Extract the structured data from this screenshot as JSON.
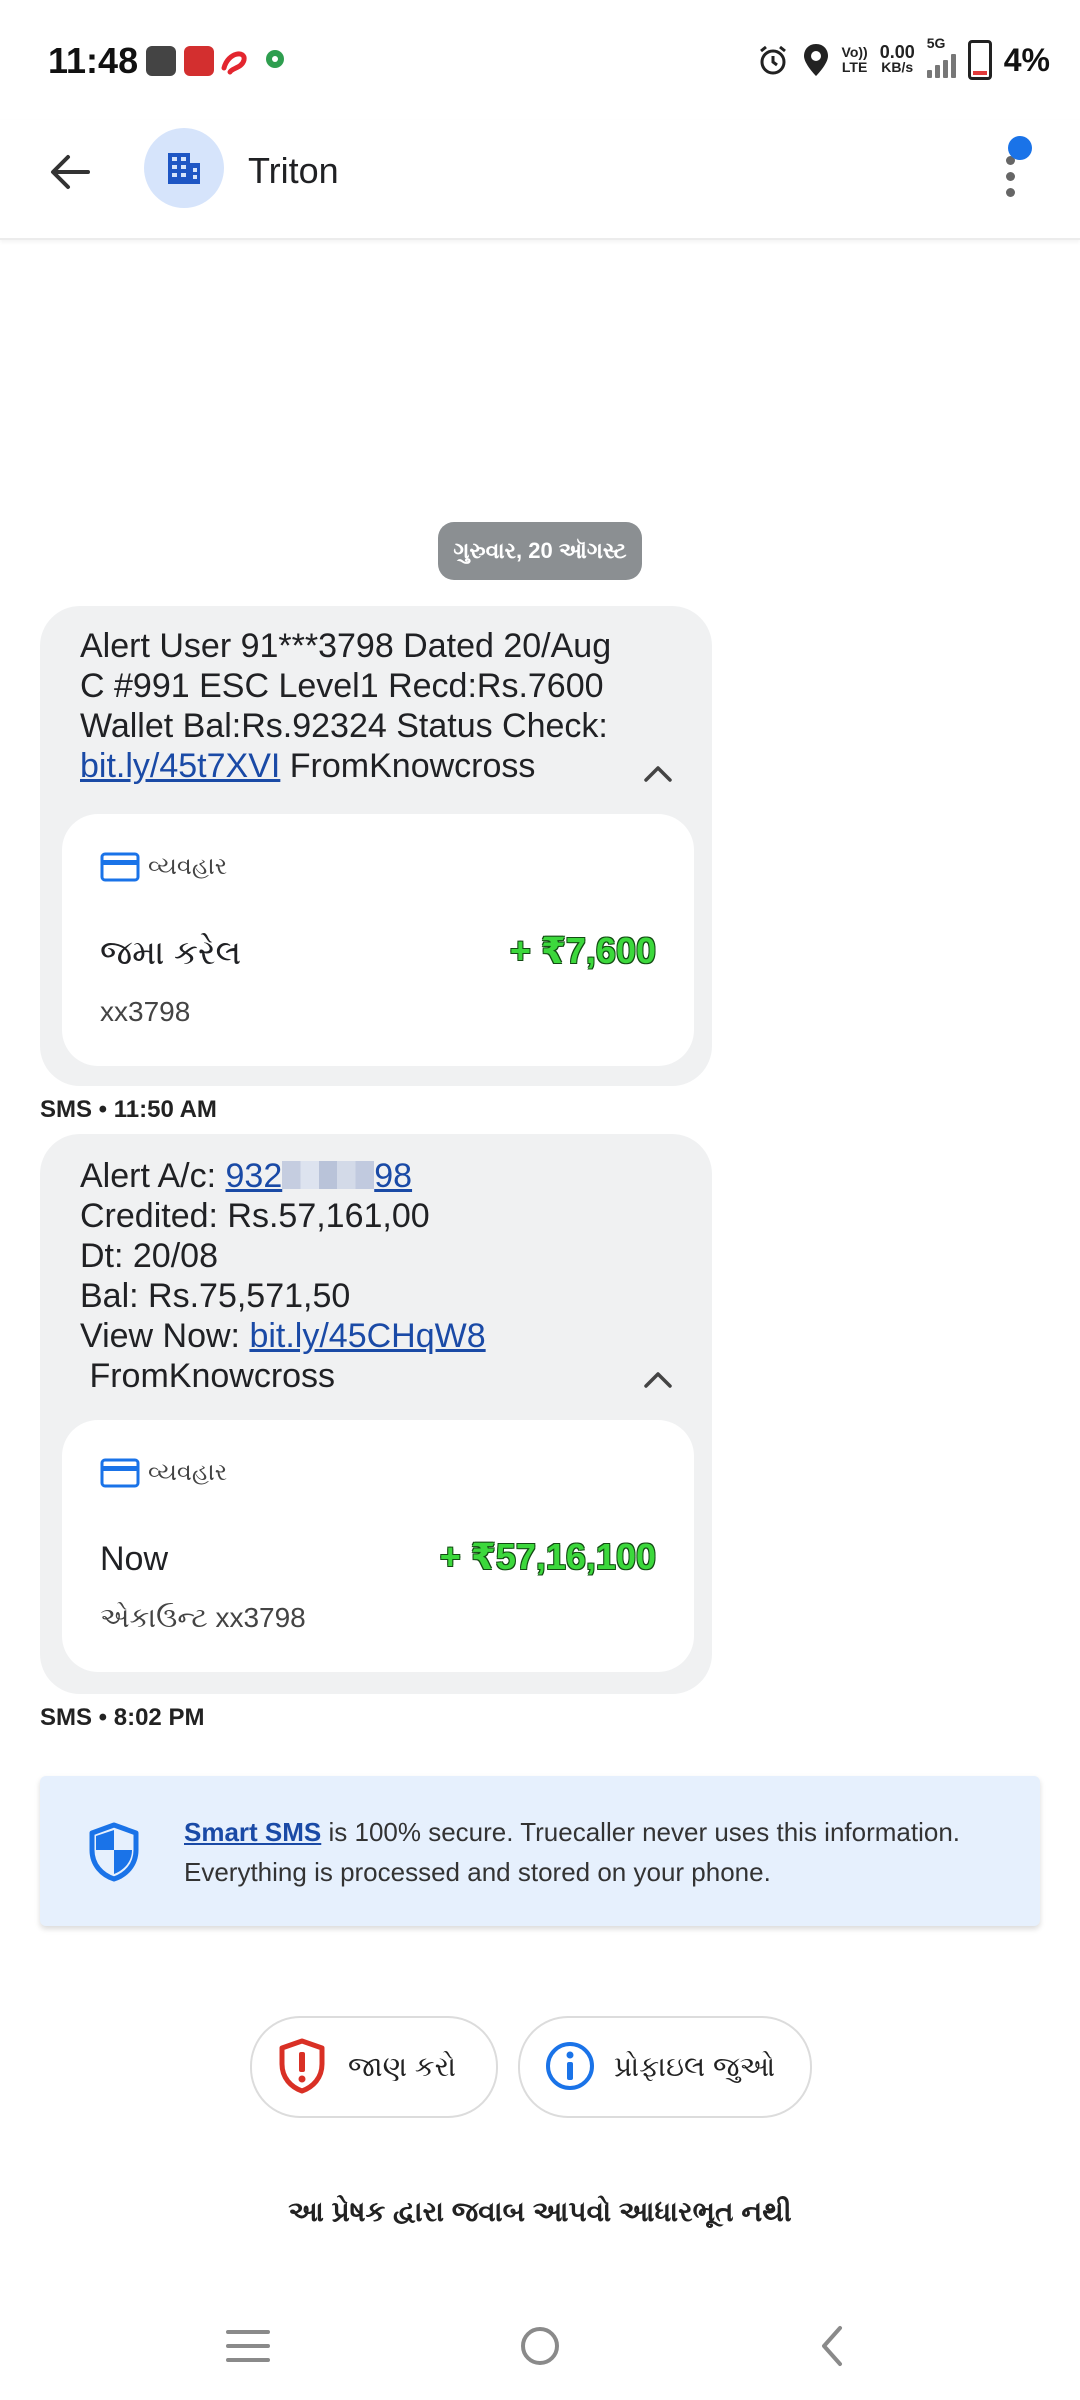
{
  "status_bar": {
    "time": "11:48",
    "network_speed": "0.00",
    "network_unit": "KB/s",
    "volte": "Vo))",
    "lte": "LTE",
    "net_type": "5G",
    "battery": "4%"
  },
  "app_bar": {
    "contact_name": "Triton"
  },
  "date_chip": "ગુરુવાર, 20 ઑગસ્ટ",
  "messages": [
    {
      "lines": [
        "Alert User 91***3798 Dated 20/Aug",
        "C #991 ESC Level1 Recd:Rs.7600",
        "Wallet Bal:Rs.92324 Status Check:"
      ],
      "link": "bit.ly/45t7XVI",
      "after_link": " FromKnowcross",
      "card": {
        "header": "વ્યવહાર",
        "label": "જમા કરેલ",
        "amount": "+ ₹7,600",
        "sub": "xx3798"
      },
      "meta": "SMS • 11:50 AM"
    },
    {
      "line1_prefix": "Alert A/c: ",
      "account_link_start": "932",
      "account_link_end": "98",
      "lines": [
        "Credited: Rs.57,161,00",
        "Dt: 20/08",
        "Bal: Rs.75,571,50"
      ],
      "view_prefix": "View Now: ",
      "link": "bit.ly/45CHqW8",
      "last_line": " FromKnowcross",
      "card": {
        "header": "વ્યવહાર",
        "label": "Now",
        "amount": "+ ₹57,16,100",
        "sub": "એકાઉન્ટ xx3798"
      },
      "meta": "SMS • 8:02 PM"
    }
  ],
  "smart_banner": {
    "link_text": "Smart SMS",
    "text": " is 100% secure. Truecaller never uses this information. Everything is processed and stored on your phone."
  },
  "actions": [
    {
      "label": "જાણ કરો"
    },
    {
      "label": "પ્રોફાઇલ જુઓ"
    }
  ],
  "footer_note": "આ પ્રેષક દ્વારા જવાબ આપવો આધારભૂત નથી",
  "colors": {
    "accent": "#1a73e8",
    "link": "#1a4aa6",
    "amount": "#3cd83c",
    "bubble": "#f0f1f2",
    "banner": "#e6f0fd",
    "report": "#d93025"
  }
}
